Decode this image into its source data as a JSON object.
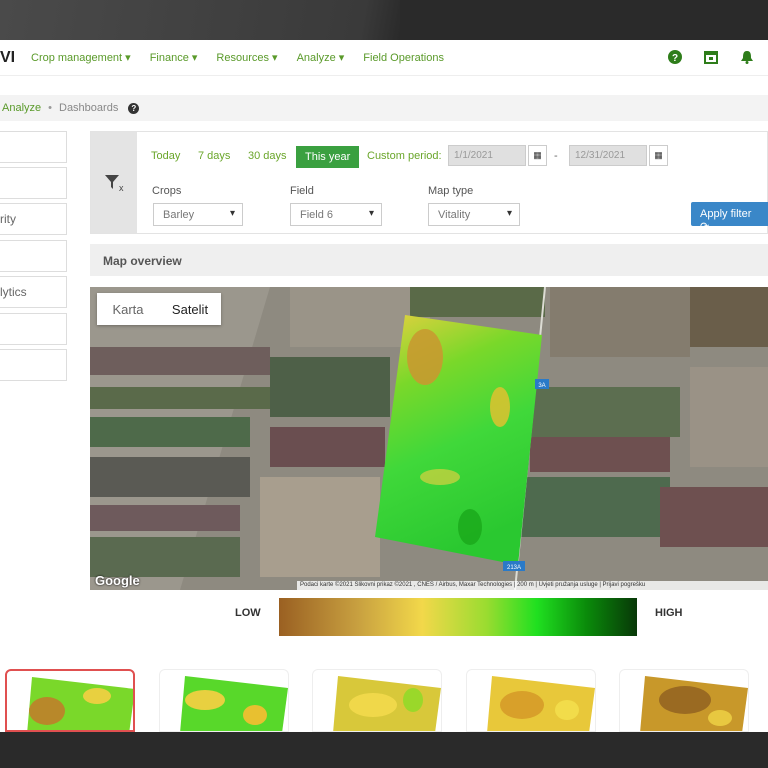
{
  "nav": {
    "brand": "VI",
    "items": [
      "Crop management ▾",
      "Finance ▾",
      "Resources ▾",
      "Analyze ▾",
      "Field Operations"
    ],
    "icons": [
      "help-icon",
      "calendar-icon",
      "bell-icon"
    ]
  },
  "breadcrumb": {
    "current": "Analyze",
    "sep": "•",
    "page": "Dashboards"
  },
  "sidebar": [
    "",
    "",
    "rity",
    "",
    "lytics",
    "",
    ""
  ],
  "filter": {
    "periods": [
      "Today",
      "7 days",
      "30 days",
      "This year"
    ],
    "active_period": "This year",
    "custom_label": "Custom period:",
    "date_from": "1/1/2021",
    "date_sep": "-",
    "date_to": "12/31/2021",
    "crops_label": "Crops",
    "crops_value": "Barley",
    "field_label": "Field",
    "field_value": "Field 6",
    "maptype_label": "Map type",
    "maptype_value": "Vitality",
    "apply": "Apply filter"
  },
  "map_overview": "Map overview",
  "map": {
    "toggle": [
      "Karta",
      "Satelit"
    ],
    "active": "Satelit",
    "google": "Google",
    "road_labels": [
      "3A",
      "213A"
    ],
    "attribution": "Podaci karte ©2021 Slikovni prikaz ©2021 , CNES / Airbus, Maxar Technologies | 200 m | Uvjeti pružanja usluge | Prijavi pogrešku"
  },
  "legend": {
    "low": "LOW",
    "high": "HIGH"
  },
  "colors": {
    "accent": "#5a9a2a",
    "active_green": "#3aa040",
    "apply_blue": "#3a87c8"
  }
}
